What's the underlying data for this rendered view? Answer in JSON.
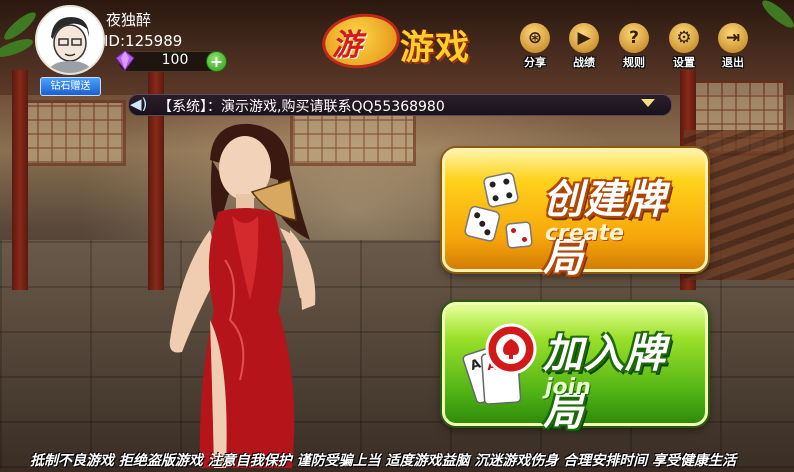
{
  "profile": {
    "username": "夜独醉",
    "user_id": "ID:125989",
    "gems": "100",
    "gem_add": "+",
    "gift_button": "钻石赠送"
  },
  "logo": {
    "badge": "游",
    "text": "游戏"
  },
  "top_buttons": [
    {
      "label": "分享",
      "icon": "share-icon"
    },
    {
      "label": "战绩",
      "icon": "camera-icon"
    },
    {
      "label": "规则",
      "icon": "question-icon"
    },
    {
      "label": "设置",
      "icon": "gear-icon"
    },
    {
      "label": "退出",
      "icon": "exit-icon"
    }
  ],
  "announcement": {
    "text": "【系统】：演示游戏,购买请联系QQ55368980"
  },
  "create_button": {
    "title": "创建牌局",
    "subtitle": "create"
  },
  "join_button": {
    "title": "加入牌局",
    "subtitle": "join"
  },
  "footer": {
    "text": "抵制不良游戏 拒绝盗版游戏 注意自我保护 谨防受骗上当 适度游戏益脑 沉迷游戏伤身 合理安排时间 享受健康生活"
  },
  "colors": {
    "create": "#ffc21a",
    "join": "#6fcc1c",
    "logo_red": "#d21c1c",
    "logo_gold": "#ffcf2a"
  }
}
